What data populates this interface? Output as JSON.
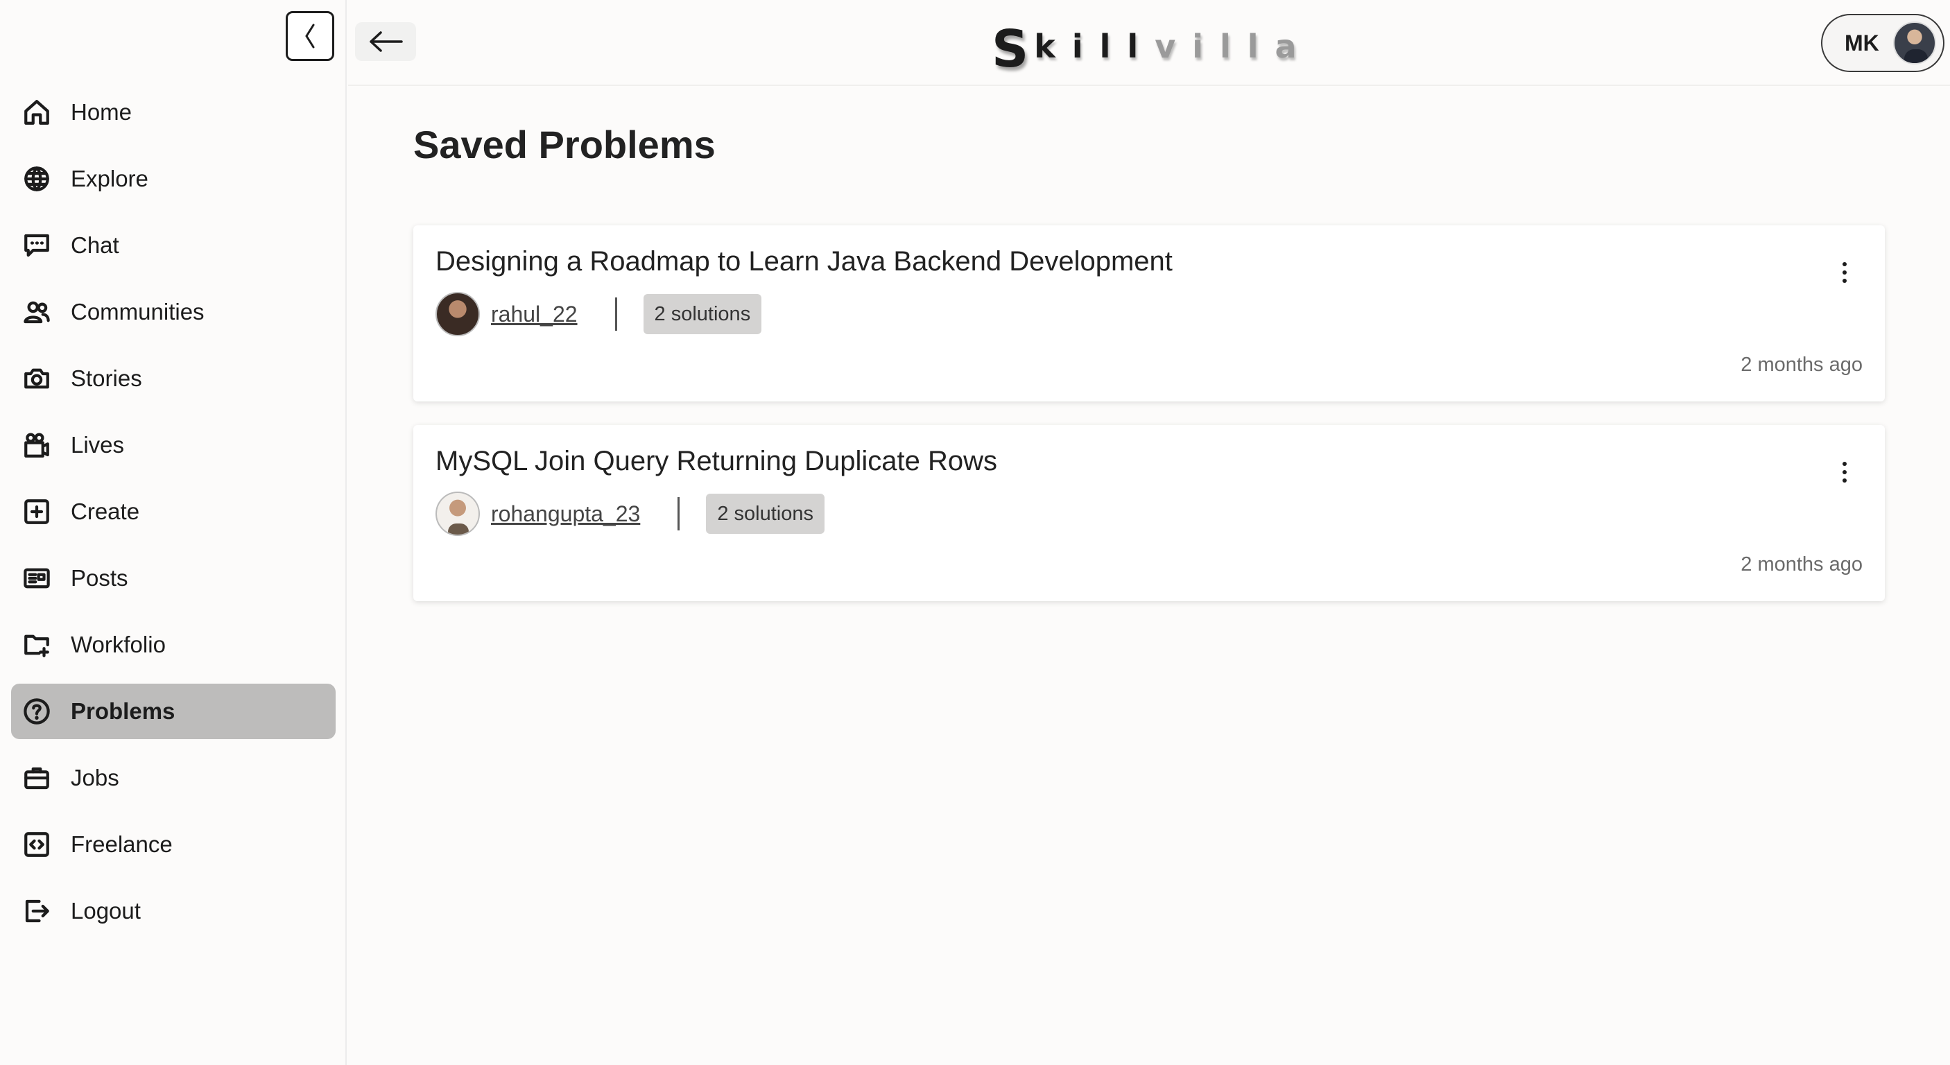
{
  "sidebar": {
    "items": [
      {
        "label": "Home",
        "icon": "home-icon"
      },
      {
        "label": "Explore",
        "icon": "globe-icon"
      },
      {
        "label": "Chat",
        "icon": "chat-icon"
      },
      {
        "label": "Communities",
        "icon": "users-icon"
      },
      {
        "label": "Stories",
        "icon": "camera-icon"
      },
      {
        "label": "Lives",
        "icon": "video-icon"
      },
      {
        "label": "Create",
        "icon": "plus-square-icon"
      },
      {
        "label": "Posts",
        "icon": "newspaper-icon"
      },
      {
        "label": "Workfolio",
        "icon": "folder-plus-icon"
      },
      {
        "label": "Problems",
        "icon": "question-circle-icon",
        "active": true
      },
      {
        "label": "Jobs",
        "icon": "briefcase-icon"
      },
      {
        "label": "Freelance",
        "icon": "code-square-icon"
      },
      {
        "label": "Logout",
        "icon": "logout-icon"
      }
    ]
  },
  "header": {
    "logo_s": "S",
    "logo_kill": "kill",
    "logo_villa": "villa",
    "profile_initials": "MK"
  },
  "main": {
    "title": "Saved Problems",
    "problems": [
      {
        "title": "Designing a Roadmap to Learn Java Backend Development",
        "author": "rahul_22",
        "solutions": "2 solutions",
        "time": "2 months ago"
      },
      {
        "title": "MySQL Join Query Returning Duplicate Rows",
        "author": "rohangupta_23",
        "solutions": "2 solutions",
        "time": "2 months ago"
      }
    ]
  },
  "colors": {
    "background": "#fcfbfa",
    "active_item": "#bdbcbb",
    "badge": "#d4d3d2"
  }
}
